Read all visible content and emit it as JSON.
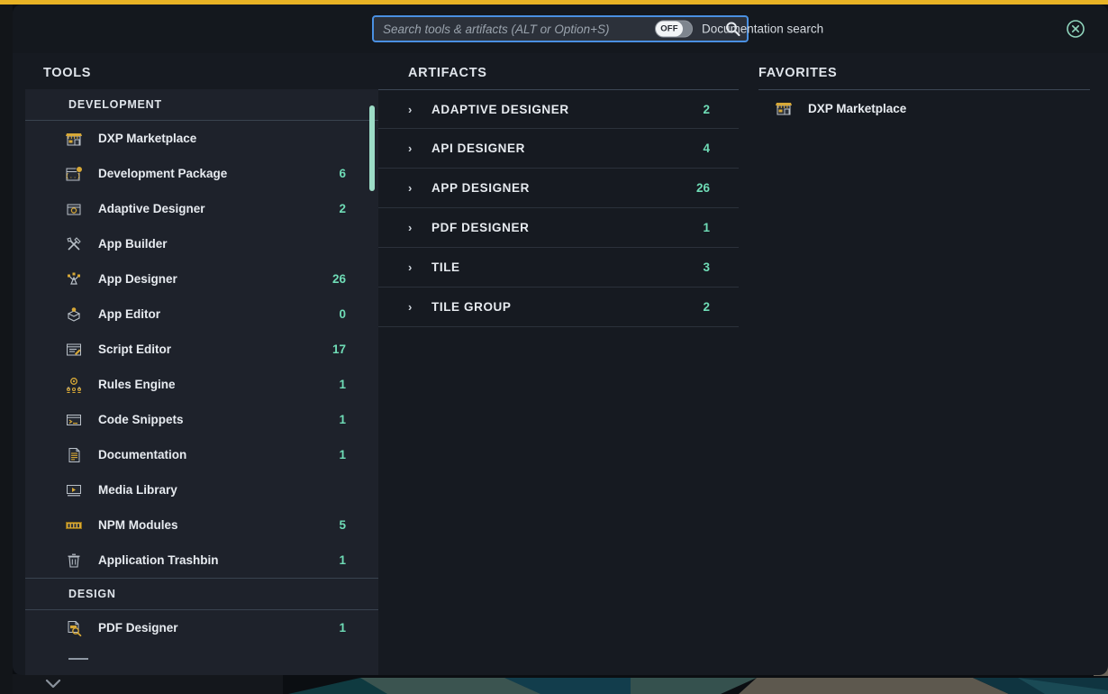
{
  "theme": {
    "accent_bar": "#e8b325",
    "panel_bg": "#161a21",
    "column_bg": "#1e222b",
    "count_color": "#6fdcb6",
    "focus_ring": "#4a90e2",
    "scrollbar_thumb": "#9cdcc6"
  },
  "search": {
    "placeholder": "Search tools & artifacts (ALT or Option+S)",
    "value": "",
    "search_icon": "search-icon",
    "toggle_state": "OFF",
    "toggle_label": "Documentation search",
    "close_icon": "close-circle-icon"
  },
  "tools": {
    "title": "TOOLS",
    "sections": [
      {
        "label": "DEVELOPMENT",
        "items": [
          {
            "label": "DXP Marketplace",
            "count": "",
            "icon": "storefront-icon"
          },
          {
            "label": "Development Package",
            "count": "6",
            "icon": "package-window-icon"
          },
          {
            "label": "Adaptive Designer",
            "count": "2",
            "icon": "lightbulb-window-icon"
          },
          {
            "label": "App Builder",
            "count": "",
            "icon": "tools-cross-icon"
          },
          {
            "label": "App Designer",
            "count": "26",
            "icon": "bezier-pen-icon"
          },
          {
            "label": "App Editor",
            "count": "0",
            "icon": "open-box-icon"
          },
          {
            "label": "Script Editor",
            "count": "17",
            "icon": "script-pencil-icon"
          },
          {
            "label": "Rules Engine",
            "count": "1",
            "icon": "gear-people-icon"
          },
          {
            "label": "Code Snippets",
            "count": "1",
            "icon": "code-window-icon"
          },
          {
            "label": "Documentation",
            "count": "1",
            "icon": "document-lines-icon"
          },
          {
            "label": "Media Library",
            "count": "",
            "icon": "media-play-icon"
          },
          {
            "label": "NPM Modules",
            "count": "5",
            "icon": "npm-box-icon"
          },
          {
            "label": "Application Trashbin",
            "count": "1",
            "icon": "trash-icon"
          }
        ]
      },
      {
        "label": "DESIGN",
        "items": [
          {
            "label": "PDF Designer",
            "count": "1",
            "icon": "pdf-magnifier-icon"
          }
        ]
      }
    ]
  },
  "artifacts": {
    "title": "ARTIFACTS",
    "items": [
      {
        "label": "ADAPTIVE DESIGNER",
        "count": "2"
      },
      {
        "label": "API DESIGNER",
        "count": "4"
      },
      {
        "label": "APP DESIGNER",
        "count": "26"
      },
      {
        "label": "PDF DESIGNER",
        "count": "1"
      },
      {
        "label": "TILE",
        "count": "3"
      },
      {
        "label": "TILE GROUP",
        "count": "2"
      }
    ]
  },
  "favorites": {
    "title": "FAVORITES",
    "items": [
      {
        "label": "DXP Marketplace",
        "icon": "storefront-icon"
      }
    ]
  },
  "background": {
    "nav_collapse_icon": "chevron-down-icon"
  }
}
